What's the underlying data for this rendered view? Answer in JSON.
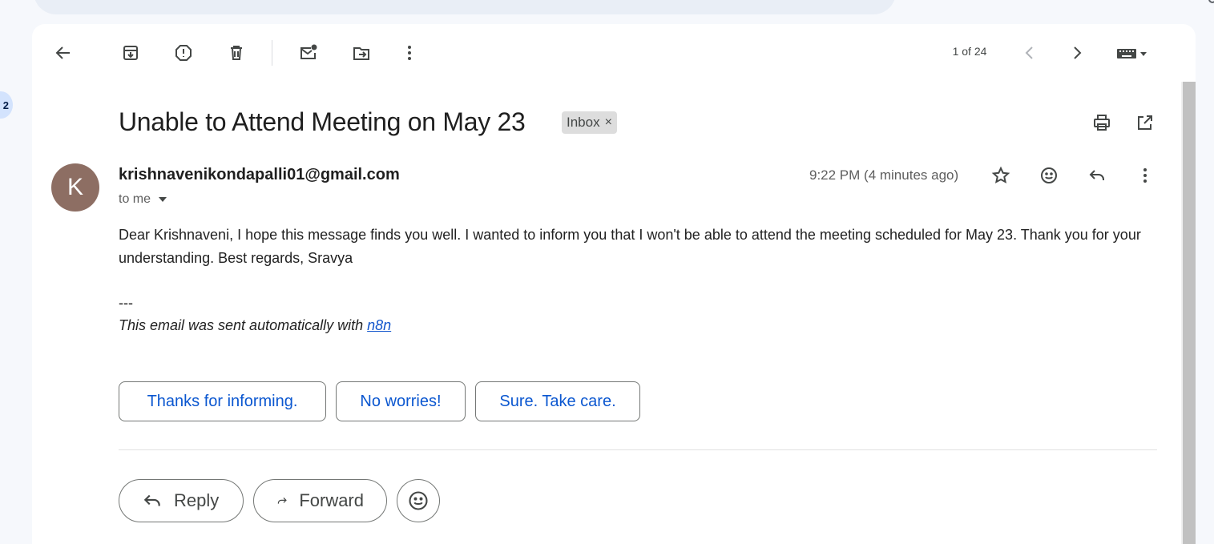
{
  "toolbar": {
    "page_counter": "1 of 24"
  },
  "email": {
    "subject": "Unable to Attend Meeting on May 23",
    "label": "Inbox",
    "label_remove": "×",
    "avatar_letter": "K",
    "sender": "krishnavenikondapalli01@gmail.com",
    "recipient": "to me",
    "timestamp": "9:22 PM (4 minutes ago)",
    "body": "Dear Krishnaveni, I hope this message finds you well. I wanted to inform you that I won't be able to attend the meeting scheduled for May 23. Thank you for your understanding. Best regards, Sravya",
    "signature_dashes": "---",
    "signature_text": "This email was sent automatically with ",
    "signature_link": "n8n"
  },
  "smart_replies": [
    "Thanks for informing.",
    "No worries!",
    "Sure. Take care."
  ],
  "actions": {
    "reply": "Reply",
    "forward": "Forward"
  },
  "sidebar": {
    "badge": "2"
  },
  "colors": {
    "accent": "#0b57d0",
    "avatar_bg": "#8d6e63",
    "link": "#1155cc"
  }
}
